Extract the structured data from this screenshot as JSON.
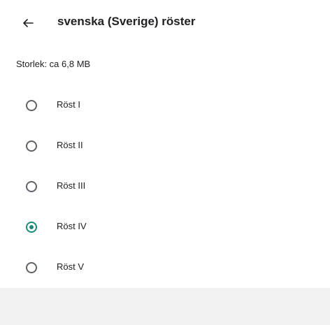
{
  "header": {
    "back_icon": "arrow-back-icon",
    "title": "svenska (Sverige) röster"
  },
  "info": {
    "size_text": "Storlek: ca 6,8 MB"
  },
  "voices": [
    {
      "label": "Röst I",
      "selected": false
    },
    {
      "label": "Röst II",
      "selected": false
    },
    {
      "label": "Röst III",
      "selected": false
    },
    {
      "label": "Röst IV",
      "selected": true
    },
    {
      "label": "Röst V",
      "selected": false
    }
  ],
  "colors": {
    "accent": "#1a8a7a",
    "text": "#202124",
    "background": "#ffffff",
    "outer_background": "#f2f2f2"
  }
}
